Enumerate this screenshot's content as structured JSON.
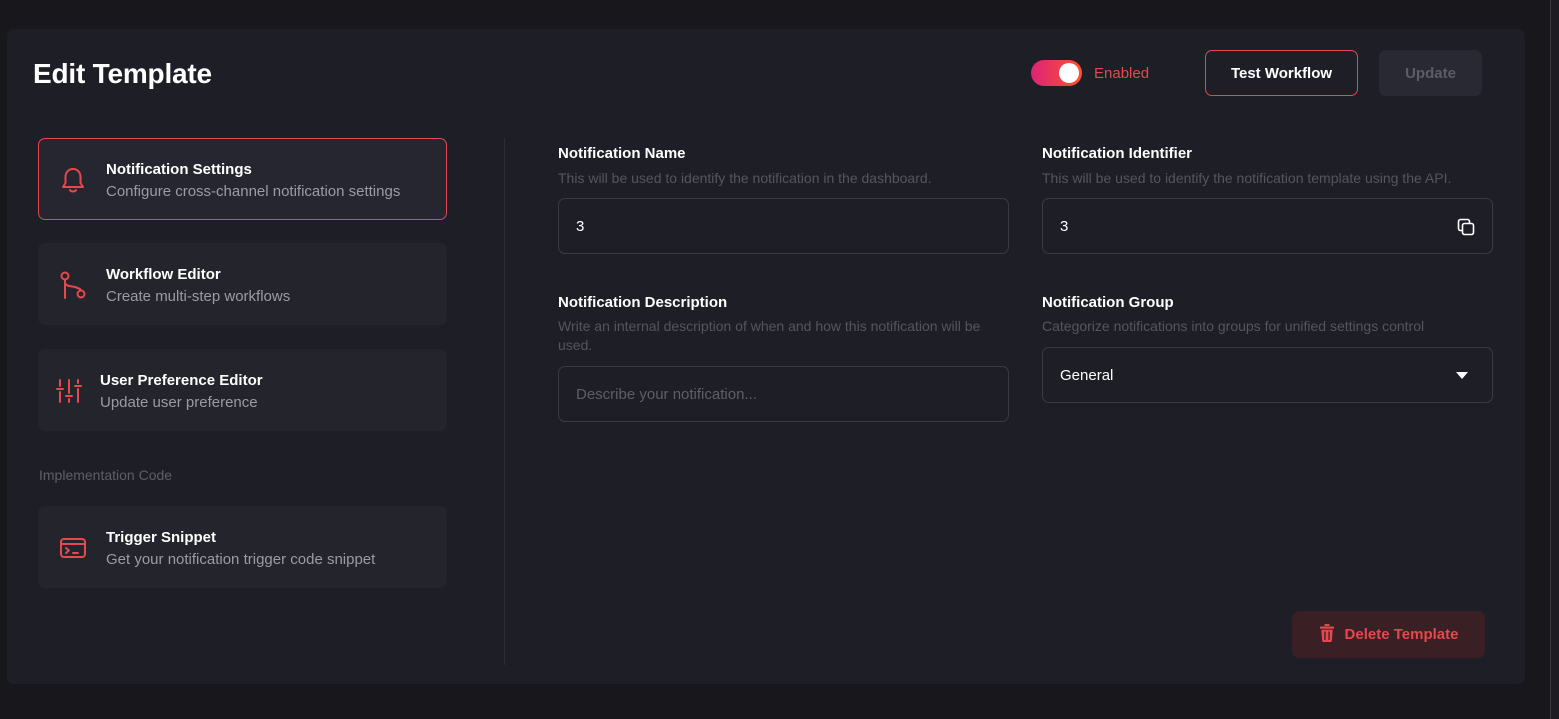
{
  "header": {
    "title": "Edit Template",
    "toggle_label": "Enabled",
    "toggle_on": true,
    "test_button": "Test Workflow",
    "update_button": "Update"
  },
  "sidebar": {
    "items": [
      {
        "title": "Notification Settings",
        "subtitle": "Configure cross-channel notification settings",
        "icon": "bell-icon",
        "active": true
      },
      {
        "title": "Workflow Editor",
        "subtitle": "Create multi-step workflows",
        "icon": "workflow-icon",
        "active": false
      },
      {
        "title": "User Preference Editor",
        "subtitle": "Update user preference",
        "icon": "sliders-icon",
        "active": false
      }
    ],
    "section_label": "Implementation Code",
    "code_items": [
      {
        "title": "Trigger Snippet",
        "subtitle": "Get your notification trigger code snippet",
        "icon": "code-card-icon"
      }
    ]
  },
  "form": {
    "name": {
      "label": "Notification Name",
      "help": "This will be used to identify the notification in the dashboard.",
      "value": "3"
    },
    "identifier": {
      "label": "Notification Identifier",
      "help": "This will be used to identify the notification template using the API.",
      "value": "3"
    },
    "description": {
      "label": "Notification Description",
      "help": "Write an internal description of when and how this notification will be used.",
      "value": "",
      "placeholder": "Describe your notification..."
    },
    "group": {
      "label": "Notification Group",
      "help": "Categorize notifications into groups for unified settings control",
      "value": "General"
    }
  },
  "delete_button": "Delete Template",
  "colors": {
    "accent": "#e5484d",
    "gradient_start": "#dd2476",
    "gradient_end": "#ff512f",
    "background": "#17171c",
    "card": "#1e1e26"
  }
}
